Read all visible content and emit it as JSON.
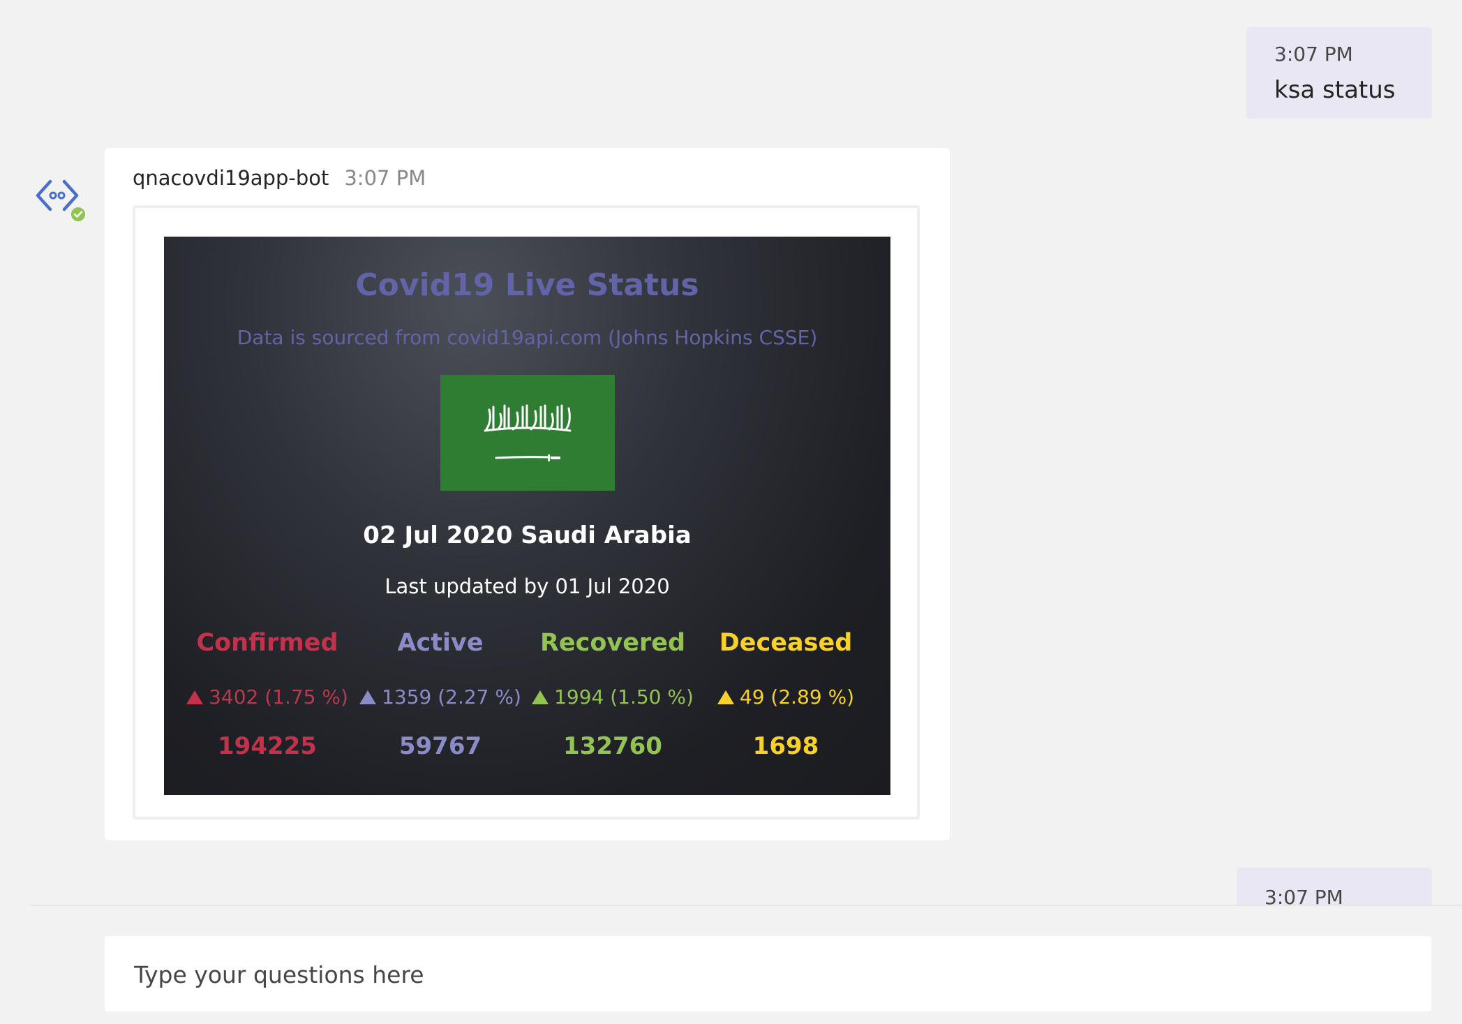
{
  "messages": {
    "user_1": {
      "time": "3:07 PM",
      "text": "ksa status"
    },
    "bot": {
      "name": "qnacovdi19app-bot",
      "time": "3:07 PM"
    },
    "user_2": {
      "time": "3:07 PM"
    }
  },
  "card": {
    "title": "Covid19 Live Status",
    "subtitle": "Data is sourced from covid19api.com (Johns Hopkins CSSE)",
    "flag_icon": "saudi-arabia-flag",
    "country": "02 Jul 2020 Saudi Arabia",
    "updated": "Last updated by 01 Jul 2020",
    "stats": {
      "confirmed": {
        "label": "Confirmed",
        "delta": "3402 (1.75 %)",
        "total": "194225",
        "color": "#c4314b"
      },
      "active": {
        "label": "Active",
        "delta": "1359 (2.27 %)",
        "total": "59767",
        "color": "#8b8cc7"
      },
      "recovered": {
        "label": "Recovered",
        "delta": "1994 (1.50 %)",
        "total": "132760",
        "color": "#92c353"
      },
      "deceased": {
        "label": "Deceased",
        "delta": "49 (2.89 %)",
        "total": "1698",
        "color": "#f8d22a"
      }
    }
  },
  "compose": {
    "placeholder": "Type your questions here"
  },
  "colors": {
    "accent": "#6264a7",
    "user_bubble": "#e8e7f3",
    "background": "#f2f2f2",
    "presence": "#92c353"
  }
}
